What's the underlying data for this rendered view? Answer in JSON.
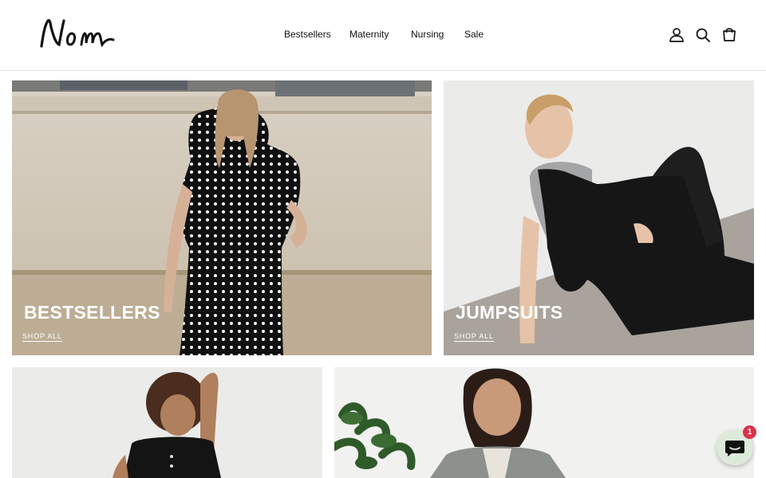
{
  "header": {
    "logo_text": "Nom",
    "nav": [
      {
        "label": "Bestsellers"
      },
      {
        "label": "Maternity"
      },
      {
        "label": "Nursing"
      },
      {
        "label": "Sale"
      }
    ],
    "icons": [
      "account-icon",
      "search-icon",
      "cart-icon"
    ]
  },
  "collections": [
    {
      "title": "BESTSELLERS",
      "link": "SHOP ALL"
    },
    {
      "title": "JUMPSUITS",
      "link": "SHOP ALL"
    },
    {
      "title": "",
      "link": ""
    },
    {
      "title": "",
      "link": ""
    }
  ],
  "chat": {
    "badge_count": "1",
    "color": "#dcead9",
    "badge_color": "#d9324a"
  }
}
